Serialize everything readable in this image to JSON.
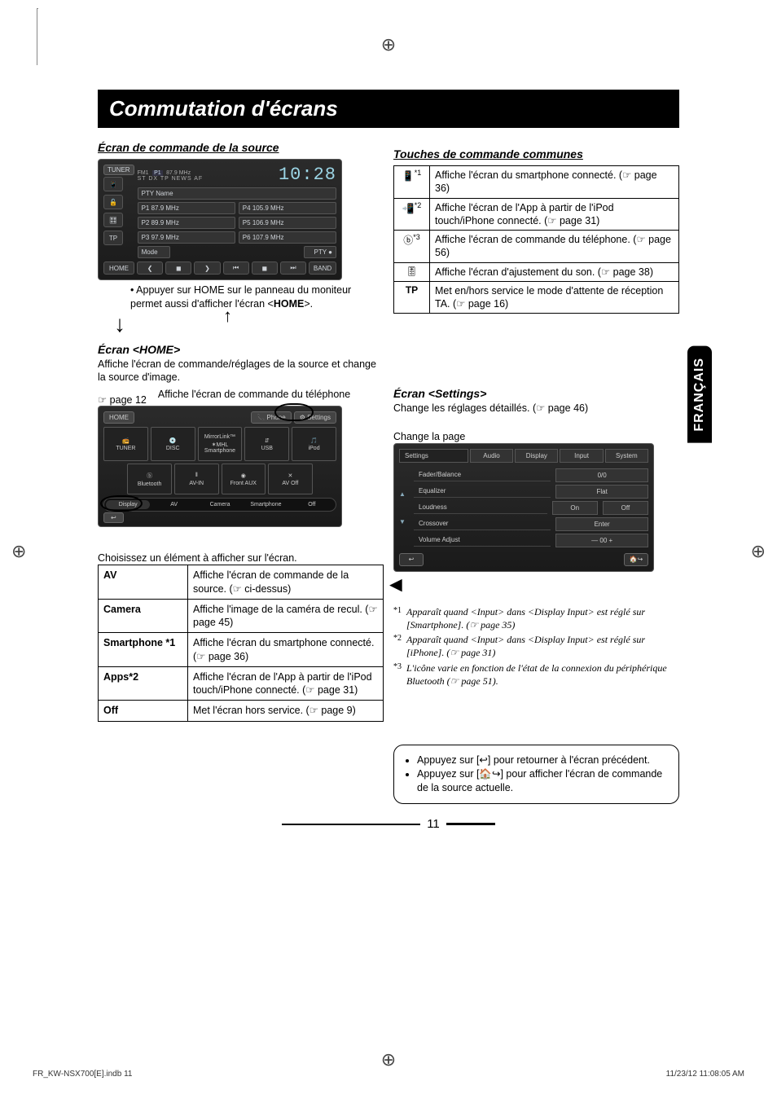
{
  "page_title": "Commutation d'écrans",
  "lang_tab": "FRANÇAIS",
  "left": {
    "source_heading": "Écran de commande de la source",
    "tuner_screen": {
      "source": "TUNER",
      "band": "FM1",
      "preset_indicator": "P1",
      "current_freq": "87.9 MHz",
      "flags": "ST   DX   TP  NEWS  AF",
      "clock": "10:28",
      "pty_label": "PTY Name",
      "side_buttons": [
        "📱",
        "🔓",
        "🎛",
        "TP"
      ],
      "presets_left": [
        {
          "n": "P1",
          "f": "87.9 MHz"
        },
        {
          "n": "P2",
          "f": "89.9 MHz"
        },
        {
          "n": "P3",
          "f": "97.9 MHz"
        }
      ],
      "presets_right": [
        {
          "n": "P4",
          "f": "105.9 MHz"
        },
        {
          "n": "P5",
          "f": "106.9 MHz"
        },
        {
          "n": "P6",
          "f": "107.9 MHz"
        }
      ],
      "mode_btn": "Mode",
      "pty_btn": "PTY ●",
      "home_btn": "HOME",
      "band_btn": "BAND",
      "transport": [
        "❮",
        "◼",
        "❯",
        "⏮",
        "◼",
        "⏭"
      ]
    },
    "source_note_prefix": "•  Appuyer sur HOME sur le panneau du moniteur permet aussi d'afficher l'écran <",
    "source_note_bold": "HOME",
    "source_note_suffix": ">.",
    "home_heading": "Écran <HOME>",
    "home_desc": "Affiche l'écran de commande/réglages de la source et change la source d'image.",
    "home_ref": "☞ page 12",
    "phone_ref": "Affiche l'écran de commande du téléphone",
    "home_screen": {
      "title": "HOME",
      "phone_btn": "📞 Phone",
      "settings_btn": "⚙ Settings",
      "row1": [
        {
          "label": "TUNER",
          "sub": ""
        },
        {
          "label": "DISC",
          "sub": ""
        },
        {
          "label": "MirrorLink™",
          "sub": "✶MHL\nSmartphone"
        },
        {
          "label": "USB",
          "sub": ""
        },
        {
          "label": "iPod",
          "sub": ""
        }
      ],
      "row2": [
        {
          "label": "Bluetooth",
          "sub": ""
        },
        {
          "label": "AV-IN",
          "sub": ""
        },
        {
          "label": "Front AUX",
          "sub": ""
        },
        {
          "label": "AV Off",
          "sub": ""
        }
      ],
      "tabs": [
        "Display",
        "AV",
        "Camera",
        "Smartphone",
        "Off"
      ],
      "back": "↩"
    },
    "choose_text": "Choisissez un élément à afficher sur l'écran.",
    "options": [
      {
        "k": "AV",
        "v": "Affiche l'écran de commande de la source. (☞ ci-dessus)"
      },
      {
        "k": "Camera",
        "v": "Affiche l'image de la caméra de recul. (☞ page 45)"
      },
      {
        "k": "Smartphone *1",
        "v": "Affiche l'écran du smartphone connecté.  (☞ page 36)"
      },
      {
        "k": "Apps*2",
        "v": "Affiche l'écran de l'App à partir de l'iPod touch/iPhone connecté. (☞ page 31)"
      },
      {
        "k": "Off",
        "v": "Met l'écran hors service. (☞ page 9)"
      }
    ]
  },
  "right": {
    "common_heading": "Touches de commande communes",
    "common_rows": [
      {
        "icon": "📱",
        "sup": "*1",
        "text": "Affiche l'écran du smartphone connecté. (☞ page 36)"
      },
      {
        "icon": "📲",
        "sup": "*2",
        "text": "Affiche l'écran de l'App à partir de l'iPod touch/iPhone connecté. (☞ page 31)"
      },
      {
        "icon": "ⓑ",
        "sup": "*3",
        "text": "Affiche l'écran de commande du téléphone. (☞ page 56)"
      },
      {
        "icon": "🎚",
        "sup": "",
        "text": "Affiche l'écran d'ajustement du son. (☞ page 38)"
      },
      {
        "icon": "TP",
        "sup": "",
        "text": "Met en/hors service le mode d'attente de réception TA. (☞ page 16)"
      }
    ],
    "settings_heading": "Écran <Settings>",
    "settings_desc": "Change les réglages détaillés. (☞ page 46)",
    "settings_pagelabel": "Change la page",
    "settings_screen": {
      "tabs": [
        "Settings",
        "Audio",
        "Display",
        "Input",
        "System"
      ],
      "rows": [
        {
          "label": "Fader/Balance",
          "val": "0/0"
        },
        {
          "label": "Equalizer",
          "val": "Flat"
        },
        {
          "label": "Loudness",
          "val": "On",
          "val2": "Off"
        },
        {
          "label": "Crossover",
          "val": "Enter"
        },
        {
          "label": "Volume Adjust",
          "val": "—   00   +"
        }
      ],
      "back": "↩",
      "source_icon": "🏠↪"
    },
    "footnotes": [
      {
        "n": "*1",
        "t": "Apparaît quand <Input> dans <Display Input> est réglé sur [Smartphone]. (☞ page 35)"
      },
      {
        "n": "*2",
        "t": "Apparaît quand <Input> dans <Display Input> est réglé sur [iPhone]. (☞ page 31)"
      },
      {
        "n": "*3",
        "t": "L'icône varie en fonction de l'état de la connexion du périphérique Bluetooth (☞ page 51)."
      }
    ],
    "tips": [
      "Appuyez sur [↩] pour retourner à l'écran précédent.",
      "Appuyez sur [🏠↪] pour afficher l'écran de commande de la source actuelle."
    ]
  },
  "page_number": "11",
  "footer_left": "FR_KW-NSX700[E].indb   11",
  "footer_right": "11/23/12   11:08:05 AM"
}
